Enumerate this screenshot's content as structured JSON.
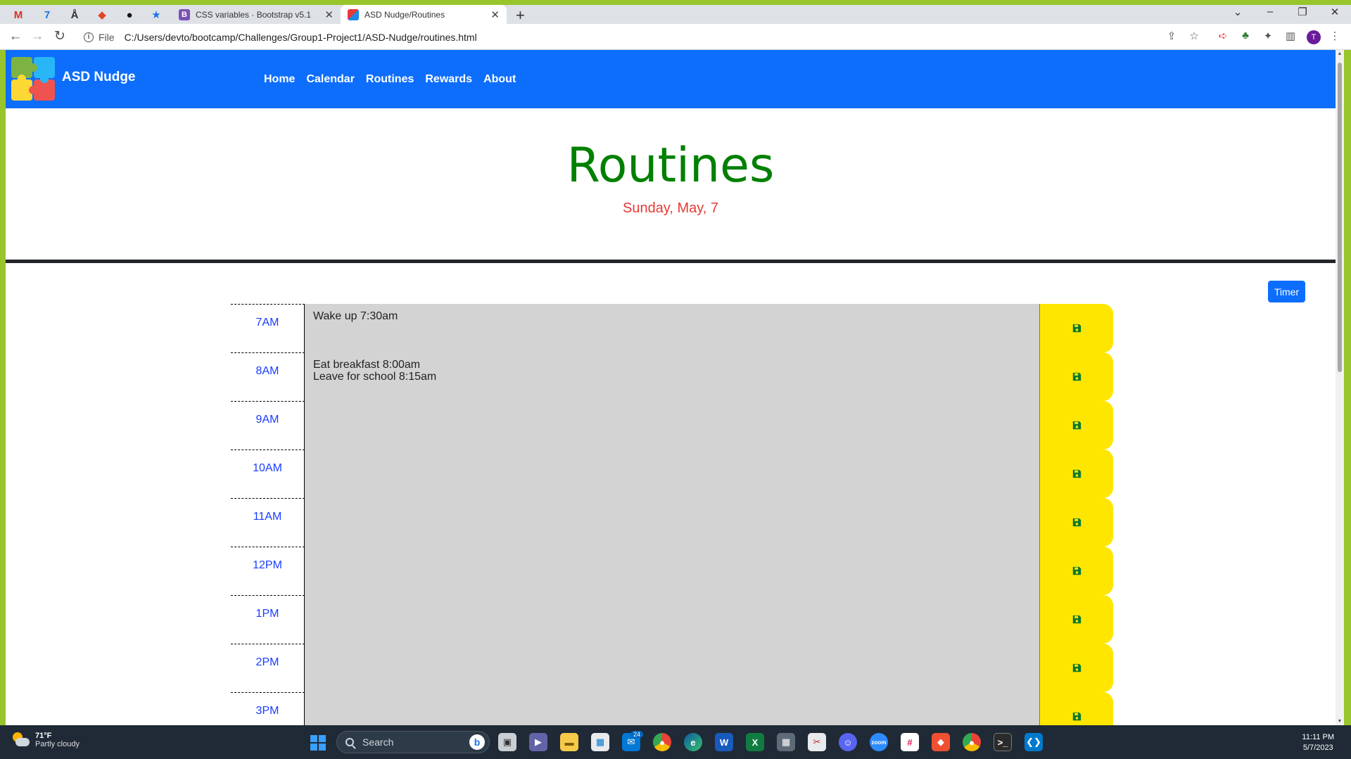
{
  "browser": {
    "tabs": [
      {
        "title": "CSS variables · Bootstrap v5.1",
        "favicon": "B",
        "active": false
      },
      {
        "title": "ASD Nudge/Routines",
        "favicon": "puzzle",
        "active": true
      }
    ],
    "address_label": "File",
    "url": "C:/Users/devto/bootcamp/Challenges/Group1-Project1/ASD-Nudge/routines.html"
  },
  "site": {
    "brand": "ASD Nudge",
    "nav": [
      "Home",
      "Calendar",
      "Routines",
      "Rewards",
      "About"
    ],
    "title": "Routines",
    "date": "Sunday, May, 7",
    "timer_label": "Timer"
  },
  "schedule": [
    {
      "hour": "7AM",
      "text": "Wake up 7:30am"
    },
    {
      "hour": "8AM",
      "text": "Eat breakfast 8:00am\nLeave for school 8:15am"
    },
    {
      "hour": "9AM",
      "text": ""
    },
    {
      "hour": "10AM",
      "text": ""
    },
    {
      "hour": "11AM",
      "text": ""
    },
    {
      "hour": "12PM",
      "text": ""
    },
    {
      "hour": "1PM",
      "text": ""
    },
    {
      "hour": "2PM",
      "text": ""
    },
    {
      "hour": "3PM",
      "text": ""
    }
  ],
  "taskbar": {
    "weather_temp": "71°F",
    "weather_desc": "Partly cloudy",
    "search_placeholder": "Search",
    "mail_badge": "24",
    "time": "11:11 PM",
    "date": "5/7/2023"
  },
  "colors": {
    "navbar": "#0d6efd",
    "title": "#008000",
    "date": "#e53935",
    "hour_text": "#1a3cff",
    "row_bg": "#d3d3d3",
    "save_bg": "#ffe600"
  }
}
